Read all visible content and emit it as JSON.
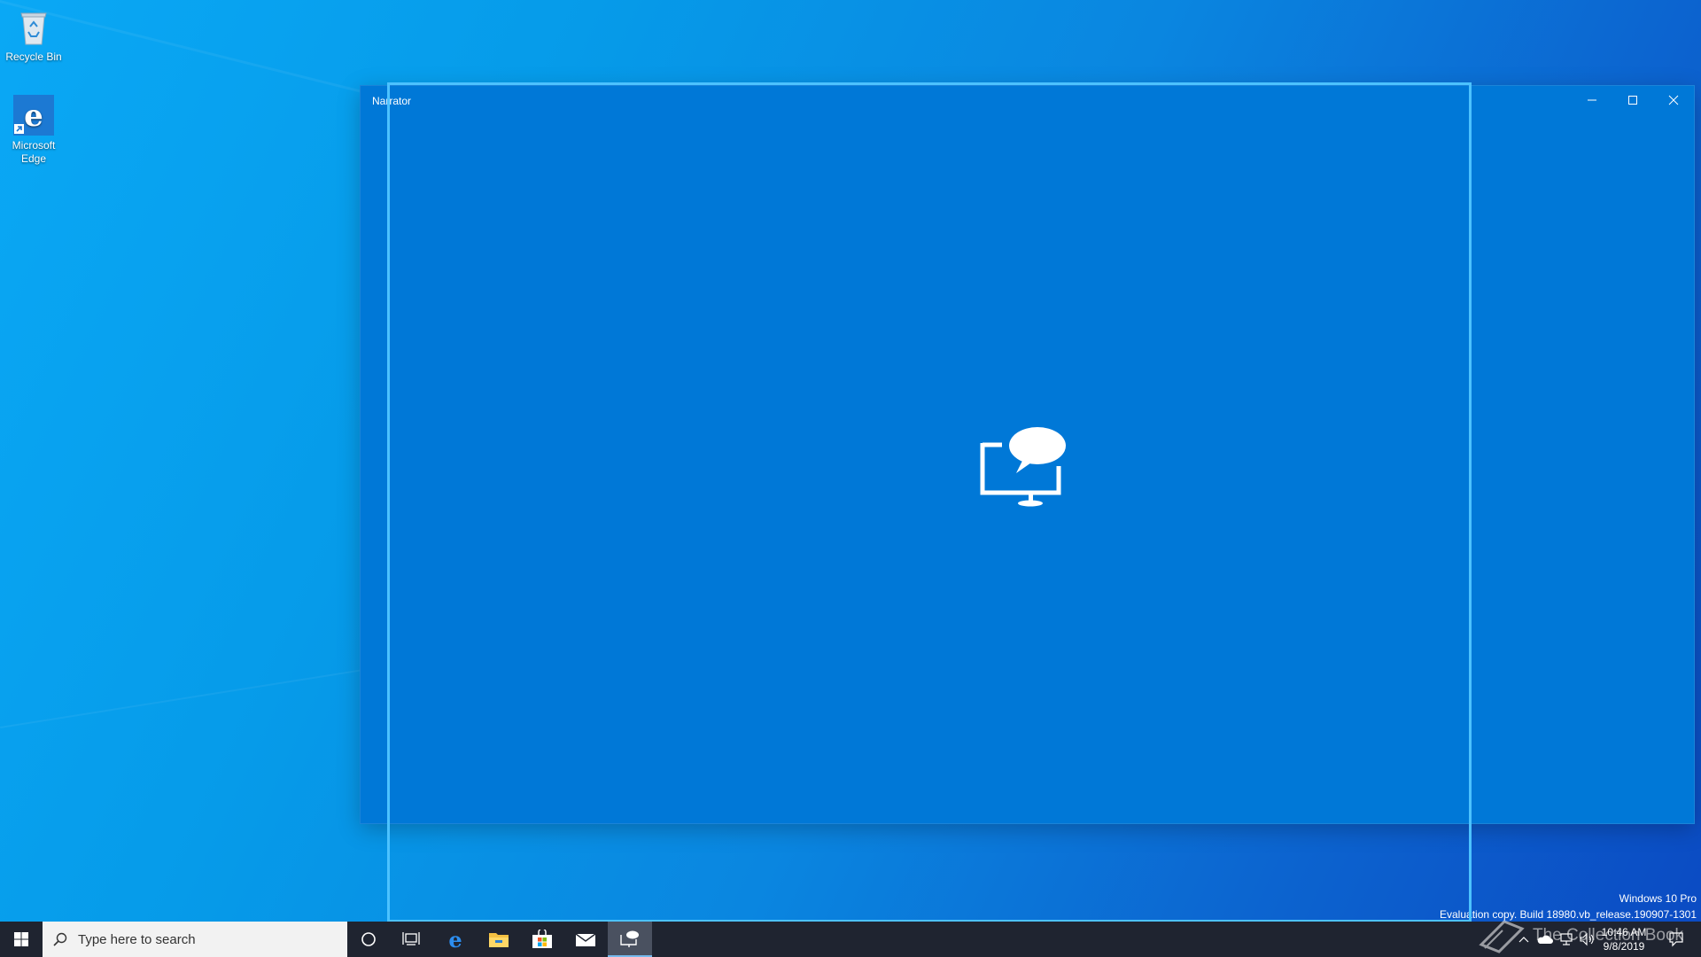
{
  "desktop": {
    "icons": [
      {
        "label": "Recycle Bin",
        "icon": "recycle-bin-icon"
      },
      {
        "label": "Microsoft Edge",
        "icon": "edge-icon"
      }
    ]
  },
  "window": {
    "title": "Narrator",
    "background_color": "#0078d7",
    "logo_icon": "narrator-monitor-speech-icon",
    "controls": {
      "minimize_icon": "minimize-icon",
      "maximize_icon": "maximize-icon",
      "close_icon": "close-icon"
    }
  },
  "watermark": {
    "edition": "Windows 10 Pro",
    "build": "Evaluation copy. Build 18980.vb_release.190907-1301",
    "collection": "The Collection Book"
  },
  "taskbar": {
    "search_placeholder": "Type here to search",
    "pinned": [
      {
        "name": "cortana-icon"
      },
      {
        "name": "task-view-icon"
      },
      {
        "name": "edge-icon"
      },
      {
        "name": "file-explorer-icon"
      },
      {
        "name": "store-icon"
      },
      {
        "name": "mail-icon"
      },
      {
        "name": "narrator-taskbar-icon",
        "active": true
      }
    ],
    "clock": {
      "time": "10:46 AM",
      "date": "9/8/2019"
    },
    "colors": {
      "taskbar": "#1f2430",
      "accent": "#0078d7"
    }
  }
}
